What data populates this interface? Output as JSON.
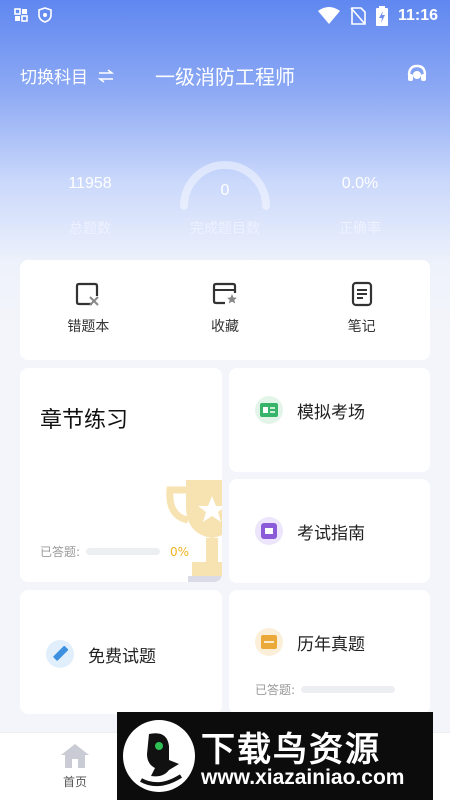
{
  "status_bar": {
    "time": "11:16"
  },
  "header": {
    "switch_label": "切换科目",
    "title": "一级消防工程师"
  },
  "stats": {
    "total": {
      "value": "11958",
      "label": "总题数"
    },
    "completed": {
      "value": "0",
      "label": "完成题目数"
    },
    "accuracy": {
      "value": "0.0%",
      "label": "正确率"
    }
  },
  "quick_actions": [
    {
      "label": "错题本",
      "icon": "wrong-book-icon"
    },
    {
      "label": "收藏",
      "icon": "favorite-folder-icon"
    },
    {
      "label": "笔记",
      "icon": "notes-icon"
    }
  ],
  "chapter_practice": {
    "title": "章节练习",
    "answered_label": "已答题:",
    "progress_text": "0%",
    "progress": 0
  },
  "mock_exam": {
    "label": "模拟考场"
  },
  "exam_guide": {
    "label": "考试指南"
  },
  "free_questions": {
    "label": "免费试题"
  },
  "past_exams": {
    "label": "历年真题",
    "answered_label": "已答题:"
  },
  "bottom_nav": {
    "home_label": "首页"
  },
  "watermark": {
    "title": "下载鸟资源",
    "url": "www.xiazainiao.com"
  },
  "colors": {
    "accent": "#5f87f0",
    "progress": "#f0b323"
  }
}
